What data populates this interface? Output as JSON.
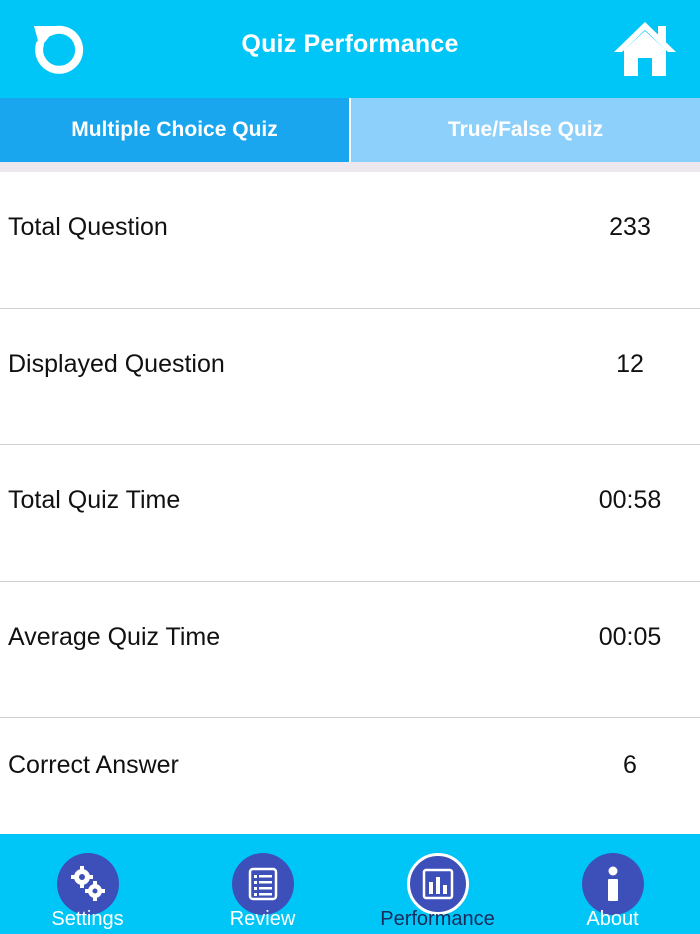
{
  "header": {
    "title": "Quiz Performance"
  },
  "tabs": [
    {
      "label": "Multiple Choice Quiz",
      "active": true
    },
    {
      "label": "True/False Quiz",
      "active": false
    }
  ],
  "stats": [
    {
      "label": "Total Question",
      "value": "233"
    },
    {
      "label": "Displayed Question",
      "value": "12"
    },
    {
      "label": "Total Quiz Time",
      "value": "00:58"
    },
    {
      "label": "Average Quiz Time",
      "value": "00:05"
    },
    {
      "label": "Correct Answer",
      "value": "6"
    }
  ],
  "bottom_nav": [
    {
      "label": "Settings",
      "icon": "gears-icon",
      "selected": false
    },
    {
      "label": "Review",
      "icon": "list-icon",
      "selected": false
    },
    {
      "label": "Performance",
      "icon": "bar-chart-icon",
      "selected": true
    },
    {
      "label": "About",
      "icon": "info-icon",
      "selected": false
    }
  ],
  "colors": {
    "header": "#00c6f8",
    "tab_active": "#1aa6ee",
    "tab_inactive": "#8dd0fb",
    "icon_circle": "#3d4fb8"
  }
}
